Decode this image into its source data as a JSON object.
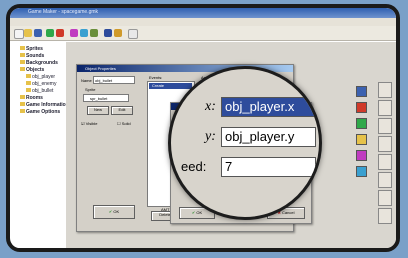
{
  "window": {
    "title": "Game Maker - spacegame.gmk"
  },
  "tree": {
    "items": [
      {
        "label": "Sprites",
        "sub": false
      },
      {
        "label": "Sounds",
        "sub": false
      },
      {
        "label": "Backgrounds",
        "sub": false
      },
      {
        "label": "Objects",
        "sub": false
      },
      {
        "label": "obj_player",
        "sub": true
      },
      {
        "label": "obj_enemy",
        "sub": true
      },
      {
        "label": "obj_bullet",
        "sub": true
      },
      {
        "label": "Rooms",
        "sub": false
      },
      {
        "label": "Game Information",
        "sub": false
      },
      {
        "label": "Game Options",
        "sub": false
      }
    ]
  },
  "object_props": {
    "title": "Object Properties",
    "name_label": "Name",
    "name_value": "obj_bullet",
    "sprite_label": "Sprite",
    "sprite_value": "spr_bullet",
    "new_button": "New",
    "edit_button": "Edit",
    "visible_label": "Visible",
    "solid_label": "Solid",
    "events_label": "Events:",
    "event_selected": "Create",
    "actions_label": "Actions:",
    "action_selected": "Move towards point (obj_player.x ...",
    "ok_button": "OK",
    "delete_button": "Delete",
    "amt_label": "AMT"
  },
  "move_dialog": {
    "title": "Move in the direction of a point",
    "applies_label": "Applies to",
    "ok_button": "OK",
    "cancel_button": "Cancel"
  },
  "magnified": {
    "x_label": "x:",
    "x_value": "obj_player.x",
    "y_label": "y:",
    "y_value": "obj_player.y",
    "speed_label": "eed:",
    "speed_value": "7"
  },
  "side_tabs": [
    "move",
    "main1",
    "main2",
    "control",
    "score",
    "extra",
    "draw",
    "code"
  ],
  "colors": {
    "titlebar": "#2f5fb0",
    "selection": "#2e4c9c",
    "dialog_bg": "#d4d0c8"
  }
}
